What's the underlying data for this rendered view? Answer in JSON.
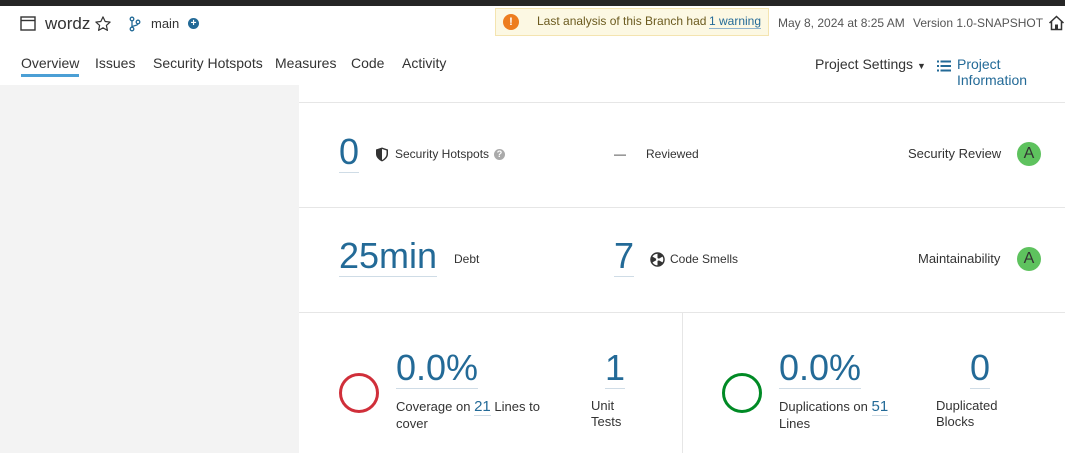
{
  "header": {
    "project_name": "wordz",
    "branch": "main",
    "warning": {
      "text": "Last analysis of this Branch had",
      "link": "1 warning"
    },
    "analysis_date": "May 8, 2024 at 8:25 AM",
    "version": "Version 1.0-SNAPSHOT",
    "tabs": [
      "Overview",
      "Issues",
      "Security Hotspots",
      "Measures",
      "Code",
      "Activity"
    ],
    "active_tab": "Overview",
    "project_settings": "Project Settings",
    "project_information": "Project Information"
  },
  "security": {
    "hotspots_value": "0",
    "hotspots_label": "Security Hotspots",
    "reviewed_value": "—",
    "reviewed_label": "Reviewed",
    "review_label": "Security Review",
    "review_rating": "A"
  },
  "maintainability": {
    "debt_value": "25min",
    "debt_label": "Debt",
    "smells_value": "7",
    "smells_label": "Code Smells",
    "label": "Maintainability",
    "rating": "A"
  },
  "coverage": {
    "value": "0.0%",
    "label_pre": "Coverage on",
    "lines_value": "21",
    "label_post": "Lines to",
    "label_post2": "cover",
    "unit_tests_value": "1",
    "unit_tests_label1": "Unit",
    "unit_tests_label2": "Tests"
  },
  "duplications": {
    "value": "0.0%",
    "label_pre": "Duplications on",
    "lines_value": "51",
    "label_post": "Lines",
    "blocks_value": "0",
    "blocks_label1": "Duplicated",
    "blocks_label2": "Blocks"
  },
  "colors": {
    "accent": "#236a97",
    "rating_a": "#5ec25e",
    "coverage_ring": "#d02f3a",
    "duplication_ring": "#008a25",
    "warning": "#ed7d20"
  }
}
